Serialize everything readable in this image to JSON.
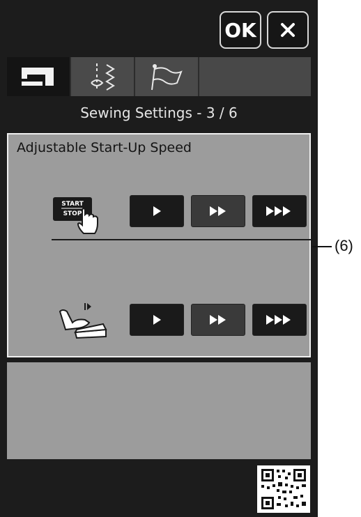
{
  "header": {
    "ok_label": "OK",
    "close_icon": "close-icon"
  },
  "tabs": [
    {
      "icon": "sewing-machine-icon",
      "active": true
    },
    {
      "icon": "stitch-icon",
      "active": false
    },
    {
      "icon": "flag-icon",
      "active": false
    }
  ],
  "page_title": "Sewing Settings  -  3 / 6",
  "panel": {
    "title": "Adjustable Start-Up Speed",
    "start_stop_row": {
      "icon": "start-stop-button-icon",
      "icon_label_top": "START",
      "icon_label_bottom": "STOP",
      "buttons": [
        "slow-speed-icon",
        "medium-speed-icon",
        "fast-speed-icon"
      ]
    },
    "foot_control_row": {
      "icon": "foot-control-icon",
      "buttons": [
        "slow-speed-icon",
        "medium-speed-icon",
        "fast-speed-icon"
      ]
    }
  },
  "callout": {
    "label": "(6)"
  },
  "colors": {
    "screen_bg": "#1c1c1c",
    "panel_bg": "#9c9c9c",
    "tab_bar_bg": "#4a4a4a",
    "button_dark": "#1a1a1a",
    "button_selected": "#3a3a3a"
  }
}
